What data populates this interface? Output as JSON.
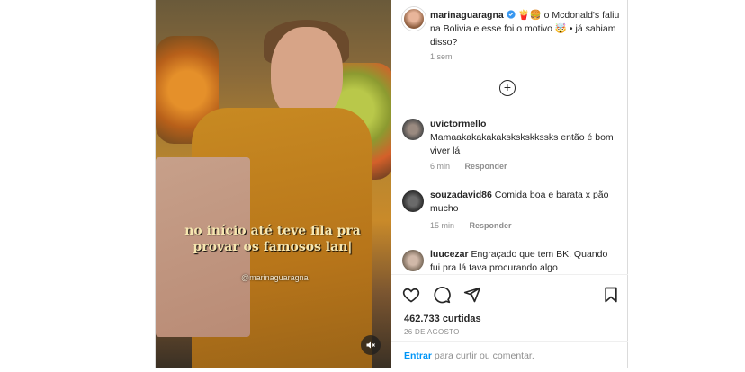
{
  "post": {
    "username": "marinaguaragna",
    "caption_emojis": "🍟🍔",
    "caption_text": "o Mcdonald's faliu na Bolivia e esse foi o motivo",
    "caption_tail": "• já sabiam disso?",
    "time_ago": "1 sem",
    "media_overlay_text": "no início até teve fila pra provar os famosos lan|",
    "media_watermark": "@marinaguaragna",
    "likes": "462.733 curtidas",
    "date": "26 DE AGOSTO",
    "comment_prompt_link": "Entrar",
    "comment_prompt_rest": "para curtir ou comentar."
  },
  "comments": [
    {
      "username": "uvictormello",
      "text": "Mamaakakakakakskskskkssks então é bom viver lá",
      "time": "6 min",
      "reply_label": "Responder"
    },
    {
      "username": "souzadavid86",
      "text": "Comida boa e barata x pão mucho",
      "time": "15 min",
      "reply_label": "Responder"
    },
    {
      "username": "luucezar",
      "text": "Engraçado que tem BK. Quando fui pra lá tava procurando algo",
      "time": "",
      "reply_label": ""
    }
  ],
  "icons": [
    "heart-icon",
    "comment-icon",
    "share-icon",
    "bookmark-icon",
    "add-circle-icon",
    "mute-icon",
    "verified-icon"
  ],
  "colors": {
    "link": "#0095f6",
    "muted": "#8e8e8e",
    "text": "#262626",
    "verified": "#3897f0"
  }
}
